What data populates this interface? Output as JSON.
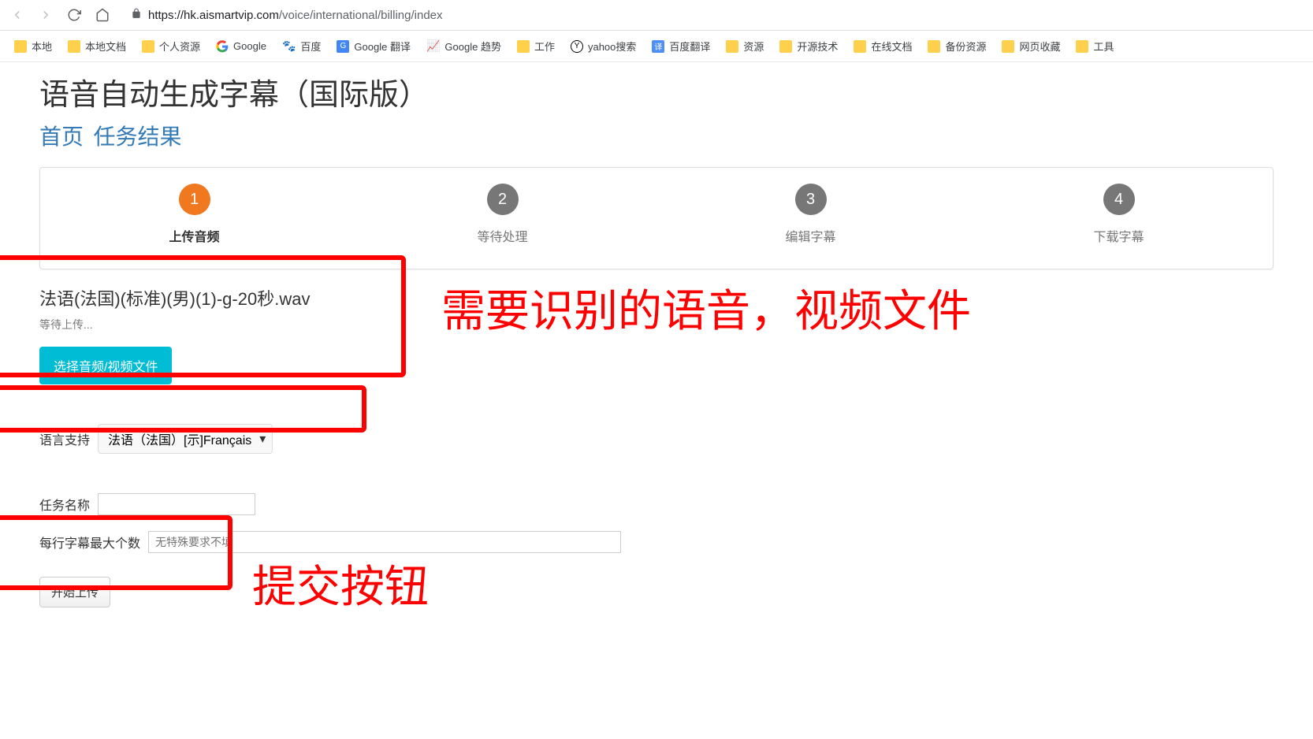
{
  "browser": {
    "url_host": "https://hk.aismartvip.com",
    "url_path": "/voice/international/billing/index"
  },
  "bookmarks": [
    {
      "label": "本地",
      "icon": "folder"
    },
    {
      "label": "本地文档",
      "icon": "folder"
    },
    {
      "label": "个人资源",
      "icon": "folder"
    },
    {
      "label": "Google",
      "icon": "google"
    },
    {
      "label": "百度",
      "icon": "baidu"
    },
    {
      "label": "Google 翻译",
      "icon": "gtrans"
    },
    {
      "label": "Google 趋势",
      "icon": "trend"
    },
    {
      "label": "工作",
      "icon": "folder"
    },
    {
      "label": "yahoo搜索",
      "icon": "yahoo"
    },
    {
      "label": "百度翻译",
      "icon": "baidutrans"
    },
    {
      "label": "资源",
      "icon": "folder"
    },
    {
      "label": "开源技术",
      "icon": "folder"
    },
    {
      "label": "在线文档",
      "icon": "folder"
    },
    {
      "label": "备份资源",
      "icon": "folder"
    },
    {
      "label": "网页收藏",
      "icon": "folder"
    },
    {
      "label": "工具",
      "icon": "folder"
    }
  ],
  "page": {
    "title": "语音自动生成字幕（国际版）",
    "nav_home": "首页",
    "nav_results": "任务结果"
  },
  "steps": [
    {
      "num": "1",
      "label": "上传音频",
      "active": true
    },
    {
      "num": "2",
      "label": "等待处理",
      "active": false
    },
    {
      "num": "3",
      "label": "编辑字幕",
      "active": false
    },
    {
      "num": "4",
      "label": "下载字幕",
      "active": false
    }
  ],
  "upload": {
    "file_name": "法语(法国)(标准)(男)(1)-g-20秒.wav",
    "status": "等待上传...",
    "choose_button": "选择音频/视频文件"
  },
  "form": {
    "lang_label": "语言支持",
    "lang_value": "法语（法国）[示]Français",
    "task_label": "任务名称",
    "maxchars_label": "每行字幕最大个数",
    "maxchars_placeholder": "无特殊要求不填",
    "submit_button": "开始上传"
  },
  "annotations": {
    "file_note": "需要识别的语音，视频文件",
    "submit_note": "提交按钮"
  }
}
